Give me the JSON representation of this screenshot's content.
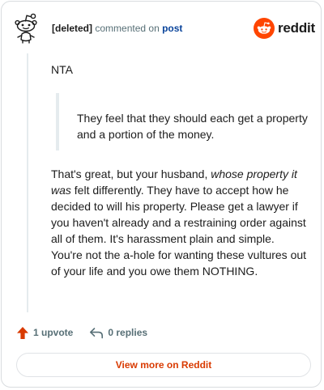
{
  "header": {
    "username": "[deleted]",
    "action_text": "commented on",
    "post_link_label": "post",
    "brand_name": "reddit"
  },
  "comment": {
    "intro": "NTA",
    "quote": "They feel that they should each get a property and a portion of the money.",
    "body_before_italic": "That's great, but your husband, ",
    "body_italic": "whose property it was",
    "body_after_italic": " felt differently. They have to accept how he decided to will his property. Please get a lawyer if you haven't already and a restraining order against all of them. It's harassment plain and simple. You're not the a-hole for wanting these vultures out of your life and you owe them NOTHING."
  },
  "footer": {
    "upvote_label": "1 upvote",
    "replies_label": "0 replies"
  },
  "cta": {
    "view_more_label": "View more on Reddit"
  },
  "colors": {
    "brand_orange": "#ff4500",
    "upvote_orange": "#d93a00",
    "link_blue": "#0a449b",
    "muted_text": "#576f76"
  },
  "icons": {
    "avatar": "deleted-user-avatar-icon",
    "brand": "reddit-logo-icon",
    "upvote": "upvote-arrow-icon",
    "reply": "reply-arrow-icon"
  }
}
